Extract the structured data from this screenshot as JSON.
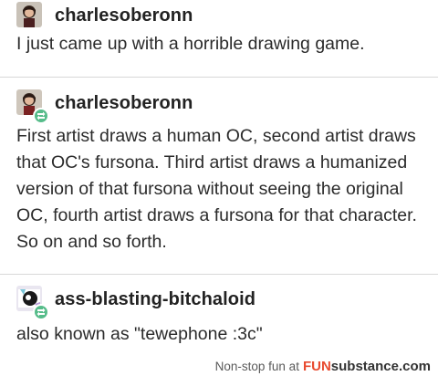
{
  "posts": [
    {
      "username": "charlesoberonn",
      "text": "I just came up with a horrible drawing game."
    },
    {
      "username": "charlesoberonn",
      "text": "First artist draws a human OC, second artist draws that OC's fursona. Third artist draws a humanized version of that fursona without seeing the original OC, fourth artist draws a fursona for that character. So on and so forth."
    },
    {
      "username": "ass-blasting-bitchaloid",
      "text": "also known as \"tewephone :3c\""
    }
  ],
  "watermark": {
    "prefix": "Non-stop fun at",
    "brand_fun": "FUN",
    "brand_rest": "substance.com"
  },
  "colors": {
    "reblog_badge": "#56bc8a",
    "watermark_brand": "#e84a2f",
    "divider": "#d8d8d8"
  }
}
